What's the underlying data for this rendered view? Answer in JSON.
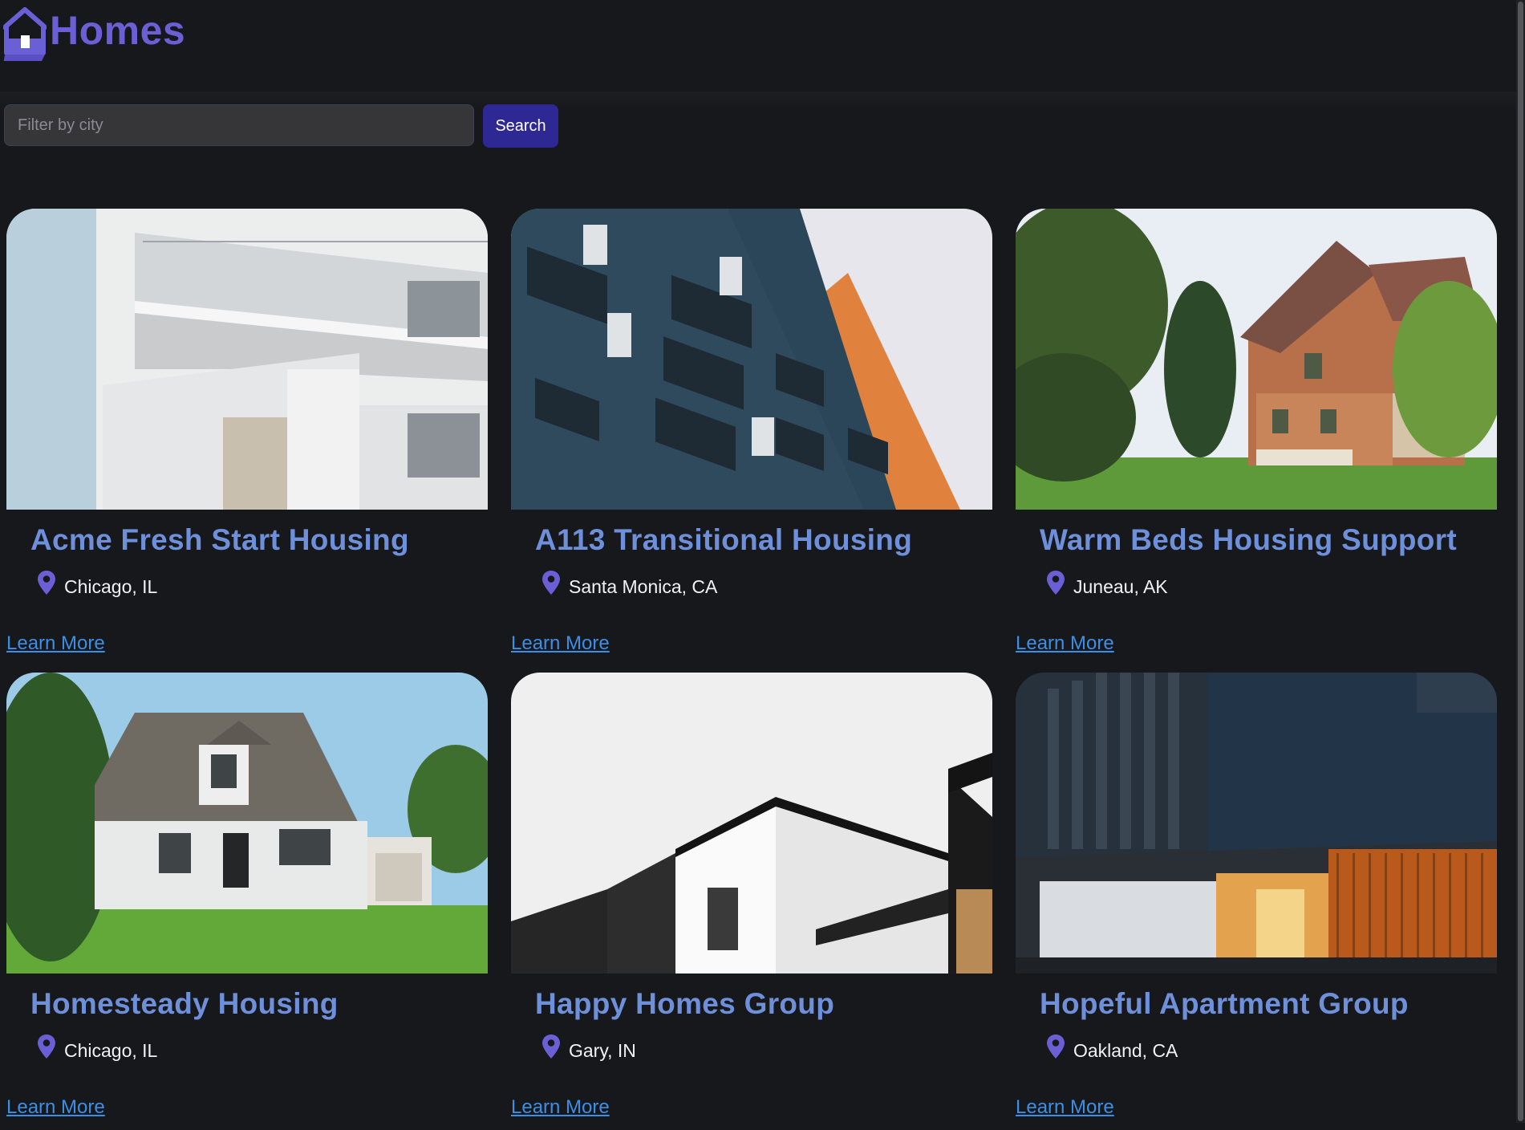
{
  "app": {
    "brand": "Homes",
    "brand_icon": "house-icon",
    "accent_color": "#6b5fd6"
  },
  "filter": {
    "placeholder": "Filter by city",
    "value": "",
    "search_label": "Search",
    "button_color": "#2e2894"
  },
  "listings": [
    {
      "title": "Acme Fresh Start Housing",
      "location": "Chicago, IL",
      "link": "Learn More",
      "photo": "white-balcony-building-photo"
    },
    {
      "title": "A113 Transitional Housing",
      "location": "Santa Monica, CA",
      "link": "Learn More",
      "photo": "blue-apartment-balconies-photo"
    },
    {
      "title": "Warm Beds Housing Support",
      "location": "Juneau, AK",
      "link": "Learn More",
      "photo": "victorian-house-photo"
    },
    {
      "title": "Homesteady Housing",
      "location": "Chicago, IL",
      "link": "Learn More",
      "photo": "white-cottage-house-photo"
    },
    {
      "title": "Happy Homes Group",
      "location": "Gary, IN",
      "link": "Learn More",
      "photo": "modern-white-house-photo"
    },
    {
      "title": "Hopeful Apartment Group",
      "location": "Oakland, CA",
      "link": "Learn More",
      "photo": "dark-modern-facade-photo"
    }
  ]
}
